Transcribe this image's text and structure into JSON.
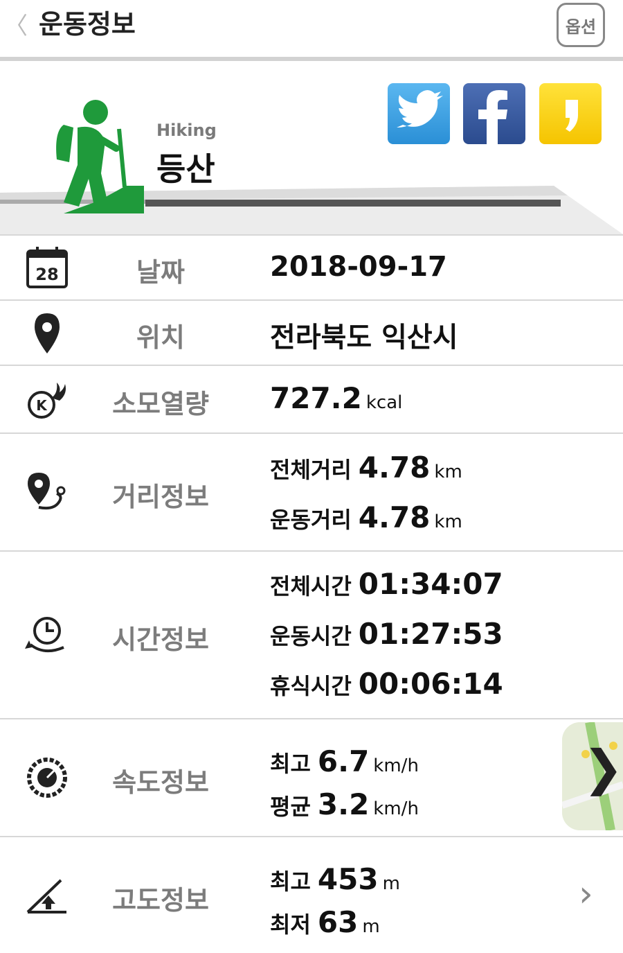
{
  "header": {
    "back_glyph": "〈",
    "title": "운동정보",
    "option_label": "옵션"
  },
  "activity": {
    "name_en": "Hiking",
    "name_ko": "등산"
  },
  "colors": {
    "accent_green": "#1f9a3b",
    "twitter": "#2a8fd6",
    "facebook": "#3b5998",
    "kakao": "#f5c400"
  },
  "rows": {
    "date": {
      "label": "날짜",
      "icon": "calendar-icon",
      "icon_day": "28",
      "value": "2018-09-17"
    },
    "location": {
      "label": "위치",
      "icon": "location-pin-icon",
      "value": "전라북도 익산시"
    },
    "calories": {
      "label": "소모열량",
      "icon": "calorie-burn-icon",
      "value": "727.2",
      "unit": "kcal"
    },
    "distance": {
      "label": "거리정보",
      "icon": "route-icon",
      "items": [
        {
          "key": "전체거리",
          "value": "4.78",
          "unit": "km"
        },
        {
          "key": "운동거리",
          "value": "4.78",
          "unit": "km"
        }
      ]
    },
    "time": {
      "label": "시간정보",
      "icon": "clock-icon",
      "items": [
        {
          "key": "전체시간",
          "value": "01:34:07"
        },
        {
          "key": "운동시간",
          "value": "01:27:53"
        },
        {
          "key": "휴식시간",
          "value": "00:06:14"
        }
      ]
    },
    "speed": {
      "label": "속도정보",
      "icon": "speedometer-icon",
      "items": [
        {
          "key": "최고",
          "value": "6.7",
          "unit": "km/h"
        },
        {
          "key": "평균",
          "value": "3.2",
          "unit": "km/h"
        }
      ],
      "map_glyph": "❯"
    },
    "altitude": {
      "label": "고도정보",
      "icon": "altitude-icon",
      "items": [
        {
          "key": "최고",
          "value": "453",
          "unit": "m"
        },
        {
          "key": "최저",
          "value": "63",
          "unit": "m"
        }
      ],
      "chevron_glyph": "›"
    }
  }
}
